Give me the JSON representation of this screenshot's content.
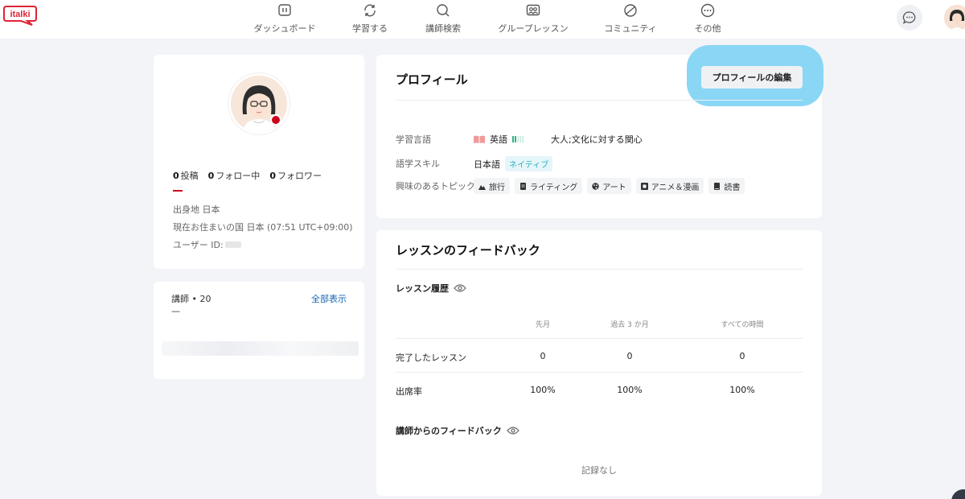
{
  "brand": {
    "logo_text": "italki",
    "color": "#e02437"
  },
  "nav": [
    {
      "label": "ダッシュボード",
      "icon": "dashboard-icon"
    },
    {
      "label": "学習する",
      "icon": "learn-icon"
    },
    {
      "label": "講師検索",
      "icon": "search-icon"
    },
    {
      "label": "グループレッスン",
      "icon": "group-lesson-icon"
    },
    {
      "label": "コミュニティ",
      "icon": "community-icon"
    },
    {
      "label": "その他",
      "icon": "more-icon"
    }
  ],
  "sidebar": {
    "stats": [
      {
        "count": "0",
        "label": "投稿"
      },
      {
        "count": "0",
        "label": "フォロー中"
      },
      {
        "count": "0",
        "label": "フォロワー"
      }
    ],
    "hometown": "出身地 日本",
    "residence": "現在お住まいの国 日本 (07:51 UTC+09:00)",
    "user_id": "ユーザー ID:",
    "tutors_title": "講師 • 20",
    "tutors_dash": "—",
    "show_all": "全部表示"
  },
  "profile": {
    "title": "プロフィール",
    "edit_button": "プロフィールの編集",
    "learning_label": "学習言語",
    "learning_language": "英語",
    "learning_level": 0.4,
    "learning_purpose": "大人;文化に対する関心",
    "skills_label": "語学スキル",
    "skill_language": "日本語",
    "skill_level": "ネイティブ",
    "topics_label": "興味のあるトピック",
    "topics": [
      {
        "label": "旅行",
        "icon": "mountain-icon"
      },
      {
        "label": "ライティング",
        "icon": "document-icon"
      },
      {
        "label": "アート",
        "icon": "palette-icon"
      },
      {
        "label": "アニメ＆漫画",
        "icon": "film-icon"
      },
      {
        "label": "読書",
        "icon": "book-icon"
      }
    ]
  },
  "feedback": {
    "title": "レッスンのフィードバック",
    "history_title": "レッスン履歴",
    "columns": [
      "先月",
      "過去 3 か月",
      "すべての時間"
    ],
    "rows": [
      {
        "label": "完了したレッスン",
        "values": [
          "0",
          "0",
          "0"
        ]
      },
      {
        "label": "出席率",
        "values": [
          "100%",
          "100%",
          "100%"
        ]
      }
    ],
    "tutor_feedback_title": "講師からのフィードバック",
    "no_record": "記録なし"
  },
  "colors": {
    "highlight": "#8ad6f5",
    "link": "#1366b5",
    "online": "#d0021b",
    "native_badge": "#2ab0c5"
  }
}
